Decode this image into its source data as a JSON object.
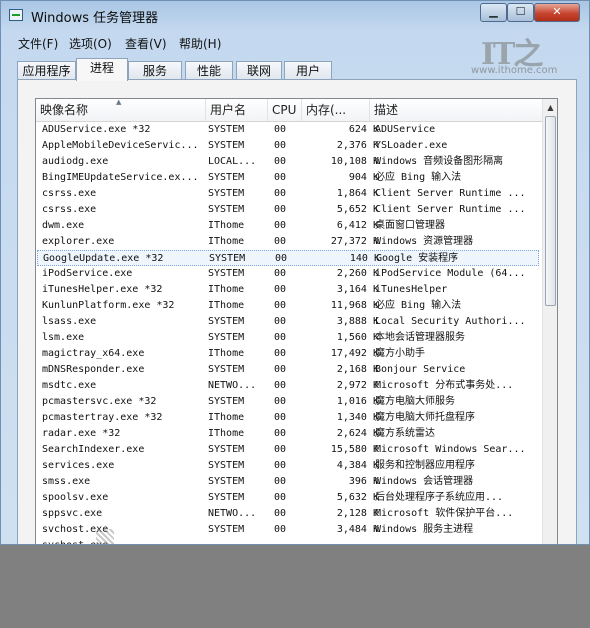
{
  "window": {
    "title": "Windows 任务管理器",
    "min_glyph": "▁",
    "max_glyph": "☐",
    "close_glyph": "✕"
  },
  "watermark": {
    "mark": "IT之",
    "url": "www.ithome.com"
  },
  "menu": [
    "文件(F)",
    "选项(O)",
    "查看(V)",
    "帮助(H)"
  ],
  "tabs": [
    {
      "label": "应用程序",
      "active": false
    },
    {
      "label": "进程",
      "active": true
    },
    {
      "label": "服务",
      "active": false
    },
    {
      "label": "性能",
      "active": false
    },
    {
      "label": "联网",
      "active": false
    },
    {
      "label": "用户",
      "active": false
    }
  ],
  "columns": [
    "映像名称",
    "用户名",
    "CPU",
    "内存(...",
    "描述"
  ],
  "sort_glyph": "▲",
  "scroll_up_glyph": "▲",
  "processes": [
    {
      "name": "ADUService.exe *32",
      "user": "SYSTEM",
      "cpu": "00",
      "mem": "624 K",
      "desc": "ADUService"
    },
    {
      "name": "AppleMobileDeviceServic...",
      "user": "SYSTEM",
      "cpu": "00",
      "mem": "2,376 K",
      "desc": "YSLoader.exe"
    },
    {
      "name": "audiodg.exe",
      "user": "LOCAL...",
      "cpu": "00",
      "mem": "10,108 K",
      "desc": "Windows 音频设备图形隔离"
    },
    {
      "name": "BingIMEUpdateService.ex...",
      "user": "SYSTEM",
      "cpu": "00",
      "mem": "904 K",
      "desc": "必应 Bing 输入法"
    },
    {
      "name": "csrss.exe",
      "user": "SYSTEM",
      "cpu": "00",
      "mem": "1,864 K",
      "desc": "Client Server Runtime ..."
    },
    {
      "name": "csrss.exe",
      "user": "SYSTEM",
      "cpu": "00",
      "mem": "5,652 K",
      "desc": "Client Server Runtime ..."
    },
    {
      "name": "dwm.exe",
      "user": "IThome",
      "cpu": "00",
      "mem": "6,412 K",
      "desc": "桌面窗口管理器"
    },
    {
      "name": "explorer.exe",
      "user": "IThome",
      "cpu": "00",
      "mem": "27,372 K",
      "desc": "Windows 资源管理器"
    },
    {
      "name": "GoogleUpdate.exe *32",
      "user": "SYSTEM",
      "cpu": "00",
      "mem": "140 K",
      "desc": "Google 安装程序",
      "selected": true
    },
    {
      "name": "iPodService.exe",
      "user": "SYSTEM",
      "cpu": "00",
      "mem": "2,260 K",
      "desc": "iPodService Module (64..."
    },
    {
      "name": "iTunesHelper.exe *32",
      "user": "IThome",
      "cpu": "00",
      "mem": "3,164 K",
      "desc": "iTunesHelper"
    },
    {
      "name": "KunlunPlatform.exe *32",
      "user": "IThome",
      "cpu": "00",
      "mem": "11,968 K",
      "desc": "必应 Bing 输入法"
    },
    {
      "name": "lsass.exe",
      "user": "SYSTEM",
      "cpu": "00",
      "mem": "3,888 K",
      "desc": "Local Security Authori..."
    },
    {
      "name": "lsm.exe",
      "user": "SYSTEM",
      "cpu": "00",
      "mem": "1,560 K",
      "desc": "本地会话管理器服务"
    },
    {
      "name": "magictray_x64.exe",
      "user": "IThome",
      "cpu": "00",
      "mem": "17,492 K",
      "desc": "魔方小助手"
    },
    {
      "name": "mDNSResponder.exe",
      "user": "SYSTEM",
      "cpu": "00",
      "mem": "2,168 K",
      "desc": "Bonjour Service"
    },
    {
      "name": "msdtc.exe",
      "user": "NETWO...",
      "cpu": "00",
      "mem": "2,972 K",
      "desc": "Microsoft 分布式事务处..."
    },
    {
      "name": "pcmastersvc.exe *32",
      "user": "SYSTEM",
      "cpu": "00",
      "mem": "1,016 K",
      "desc": "魔方电脑大师服务"
    },
    {
      "name": "pcmastertray.exe *32",
      "user": "IThome",
      "cpu": "00",
      "mem": "1,340 K",
      "desc": "魔方电脑大师托盘程序"
    },
    {
      "name": "radar.exe *32",
      "user": "IThome",
      "cpu": "00",
      "mem": "2,624 K",
      "desc": "魔方系统雷达"
    },
    {
      "name": "SearchIndexer.exe",
      "user": "SYSTEM",
      "cpu": "00",
      "mem": "15,580 K",
      "desc": "Microsoft Windows Sear..."
    },
    {
      "name": "services.exe",
      "user": "SYSTEM",
      "cpu": "00",
      "mem": "4,384 K",
      "desc": "服务和控制器应用程序"
    },
    {
      "name": "smss.exe",
      "user": "SYSTEM",
      "cpu": "00",
      "mem": "396 K",
      "desc": "Windows 会话管理器"
    },
    {
      "name": "spoolsv.exe",
      "user": "SYSTEM",
      "cpu": "00",
      "mem": "5,632 K",
      "desc": "后台处理程序子系统应用..."
    },
    {
      "name": "sppsvc.exe",
      "user": "NETWO...",
      "cpu": "00",
      "mem": "2,128 K",
      "desc": "Microsoft 软件保护平台..."
    },
    {
      "name": "svchost.exe",
      "user": "SYSTEM",
      "cpu": "00",
      "mem": "3,484 K",
      "desc": "Windows 服务主进程"
    },
    {
      "name": "svchost.exe",
      "user": "",
      "cpu": "",
      "mem": "",
      "desc": ""
    }
  ]
}
